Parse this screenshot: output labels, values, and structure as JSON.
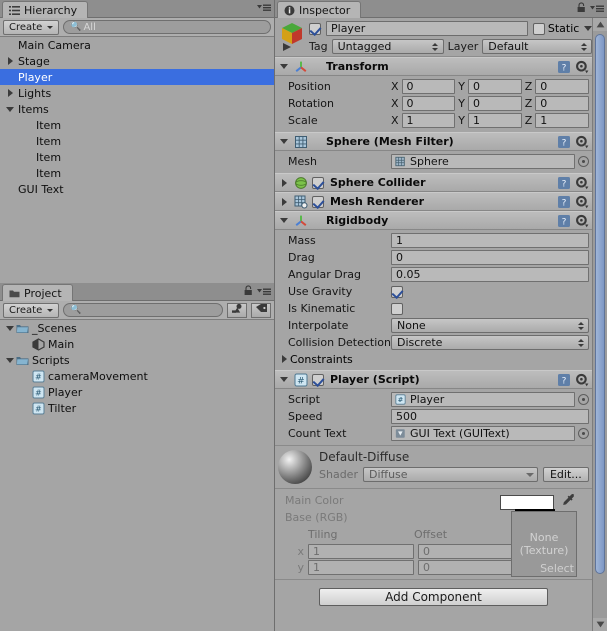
{
  "app": {
    "theme_bg": "#a5a5a5",
    "accent_selection": "#3a6ee0"
  },
  "hierarchy": {
    "tab_label": "Hierarchy",
    "tab_icon": "hierarchy-list-icon",
    "create_label": "Create",
    "search_placeholder": "All",
    "search_value": "",
    "items": [
      {
        "label": "Main Camera",
        "indent": 1,
        "arrow": "none",
        "selected": false
      },
      {
        "label": "Stage",
        "indent": 1,
        "arrow": "closed",
        "selected": false
      },
      {
        "label": "Player",
        "indent": 1,
        "arrow": "none",
        "selected": true
      },
      {
        "label": "Lights",
        "indent": 1,
        "arrow": "closed",
        "selected": false
      },
      {
        "label": "Items",
        "indent": 1,
        "arrow": "open",
        "selected": false
      },
      {
        "label": "Item",
        "indent": 2,
        "arrow": "none",
        "selected": false
      },
      {
        "label": "Item",
        "indent": 2,
        "arrow": "none",
        "selected": false
      },
      {
        "label": "Item",
        "indent": 2,
        "arrow": "none",
        "selected": false
      },
      {
        "label": "Item",
        "indent": 2,
        "arrow": "none",
        "selected": false
      },
      {
        "label": "GUI Text",
        "indent": 1,
        "arrow": "none",
        "selected": false
      }
    ]
  },
  "project": {
    "tab_label": "Project",
    "tab_icon": "folder-icon",
    "create_label": "Create",
    "search_placeholder": "",
    "search_value": "",
    "filter_type_icon": "filter-by-type-icon",
    "filter_label_icon": "filter-by-label-icon",
    "items": [
      {
        "label": "_Scenes",
        "indent": 0,
        "arrow": "open",
        "icon": "folder-icon"
      },
      {
        "label": "Main",
        "indent": 1,
        "arrow": "none",
        "icon": "unity-scene-icon"
      },
      {
        "label": "Scripts",
        "indent": 0,
        "arrow": "open",
        "icon": "folder-icon"
      },
      {
        "label": "cameraMovement",
        "indent": 1,
        "arrow": "none",
        "icon": "csharp-script-icon"
      },
      {
        "label": "Player",
        "indent": 1,
        "arrow": "none",
        "icon": "csharp-script-icon"
      },
      {
        "label": "Tilter",
        "indent": 1,
        "arrow": "none",
        "icon": "csharp-script-icon"
      }
    ]
  },
  "inspector": {
    "tab_label": "Inspector",
    "tab_icon": "info-icon",
    "object": {
      "icon": "gameobject-cube-icon",
      "enabled": true,
      "name": "Player",
      "static_label": "Static",
      "static_checked": false,
      "tag_label": "Tag",
      "tag_value": "Untagged",
      "layer_label": "Layer",
      "layer_value": "Default"
    },
    "components": [
      {
        "name": "transform",
        "title": "Transform",
        "icon": "transform-axis-icon",
        "expanded": true,
        "has_enable_checkbox": false,
        "rows": [
          {
            "label": "Position",
            "type": "vector3",
            "x": "0",
            "y": "0",
            "z": "0"
          },
          {
            "label": "Rotation",
            "type": "vector3",
            "x": "0",
            "y": "0",
            "z": "0"
          },
          {
            "label": "Scale",
            "type": "vector3",
            "x": "1",
            "y": "1",
            "z": "1"
          }
        ]
      },
      {
        "name": "mesh-filter",
        "title": "Sphere (Mesh Filter)",
        "icon": "mesh-filter-icon",
        "expanded": true,
        "has_enable_checkbox": false,
        "rows": [
          {
            "label": "Mesh",
            "type": "object",
            "value": "Sphere",
            "value_icon": "mesh-icon"
          }
        ]
      },
      {
        "name": "sphere-collider",
        "title": "Sphere Collider",
        "icon": "sphere-collider-icon",
        "expanded": false,
        "has_enable_checkbox": true,
        "enabled": true,
        "rows": []
      },
      {
        "name": "mesh-renderer",
        "title": "Mesh Renderer",
        "icon": "mesh-renderer-icon",
        "expanded": false,
        "has_enable_checkbox": true,
        "enabled": true,
        "rows": []
      },
      {
        "name": "rigidbody",
        "title": "Rigidbody",
        "icon": "rigidbody-icon",
        "expanded": true,
        "has_enable_checkbox": false,
        "rows": [
          {
            "label": "Mass",
            "type": "text",
            "value": "1"
          },
          {
            "label": "Drag",
            "type": "text",
            "value": "0"
          },
          {
            "label": "Angular Drag",
            "type": "text",
            "value": "0.05"
          },
          {
            "label": "Use Gravity",
            "type": "checkbox",
            "checked": true
          },
          {
            "label": "Is Kinematic",
            "type": "checkbox",
            "checked": false
          },
          {
            "label": "Interpolate",
            "type": "dropdown",
            "value": "None"
          },
          {
            "label": "Collision Detection",
            "type": "dropdown",
            "value": "Discrete"
          },
          {
            "label": "Constraints",
            "type": "foldout",
            "expanded": false
          }
        ]
      },
      {
        "name": "player-script",
        "title": "Player (Script)",
        "icon": "csharp-script-icon",
        "expanded": true,
        "has_enable_checkbox": true,
        "enabled": true,
        "rows": [
          {
            "label": "Script",
            "type": "object",
            "value": "Player",
            "value_icon": "csharp-script-icon"
          },
          {
            "label": "Speed",
            "type": "text",
            "value": "500"
          },
          {
            "label": "Count Text",
            "type": "object",
            "value": "GUI Text (GUIText)",
            "value_icon": "guitext-icon"
          }
        ]
      }
    ],
    "material": {
      "name": "Default-Diffuse",
      "preview_icon": "material-sphere-preview",
      "shader_label": "Shader",
      "shader_value": "Diffuse",
      "edit_label": "Edit...",
      "main_color_label": "Main Color",
      "main_color_value": "#ffffff",
      "base_rgb_label": "Base (RGB)",
      "texture_none_line1": "None",
      "texture_none_line2": "(Texture)",
      "texture_select_label": "Select",
      "tiling_label": "Tiling",
      "offset_label": "Offset",
      "rows": [
        {
          "axis": "x",
          "tiling": "1",
          "offset": "0"
        },
        {
          "axis": "y",
          "tiling": "1",
          "offset": "0"
        }
      ]
    },
    "add_component_label": "Add Component"
  }
}
